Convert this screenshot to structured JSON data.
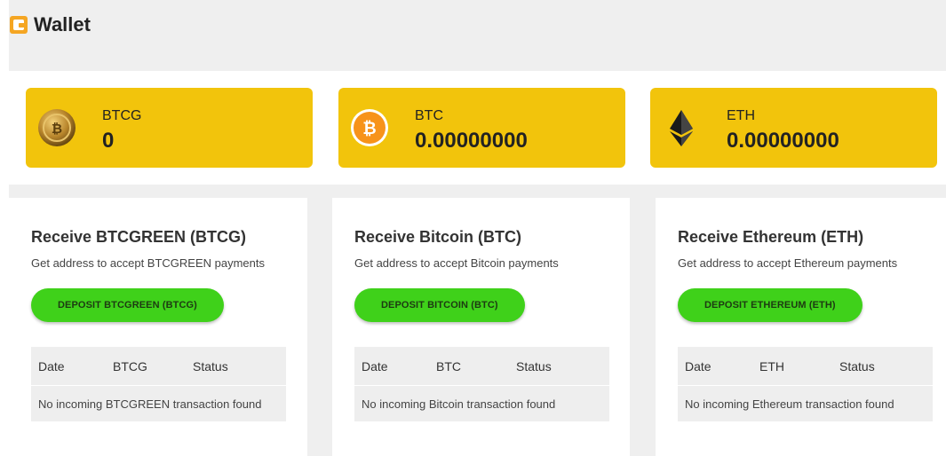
{
  "header": {
    "title": "Wallet",
    "icon": "wallet-icon"
  },
  "colors": {
    "card": "#f2c40c",
    "button": "#3fd11a",
    "background": "#efefef"
  },
  "balances": [
    {
      "symbol": "BTCG",
      "amount": "0",
      "icon": "btcg-coin-icon"
    },
    {
      "symbol": "BTC",
      "amount": "0.00000000",
      "icon": "bitcoin-icon"
    },
    {
      "symbol": "ETH",
      "amount": "0.00000000",
      "icon": "ethereum-icon"
    }
  ],
  "panels": [
    {
      "title": "Receive BTCGREEN (BTCG)",
      "subtitle": "Get address to accept BTCGREEN payments",
      "button": "DEPOSIT BTCGREEN (BTCG)",
      "columns": [
        "Date",
        "BTCG",
        "Status"
      ],
      "empty": "No incoming BTCGREEN transaction found"
    },
    {
      "title": "Receive Bitcoin (BTC)",
      "subtitle": "Get address to accept Bitcoin payments",
      "button": "DEPOSIT BITCOIN (BTC)",
      "columns": [
        "Date",
        "BTC",
        "Status"
      ],
      "empty": "No incoming Bitcoin transaction found"
    },
    {
      "title": "Receive Ethereum (ETH)",
      "subtitle": "Get address to accept Ethereum payments",
      "button": "DEPOSIT ETHEREUM (ETH)",
      "columns": [
        "Date",
        "ETH",
        "Status"
      ],
      "empty": "No incoming Ethereum transaction found"
    }
  ]
}
